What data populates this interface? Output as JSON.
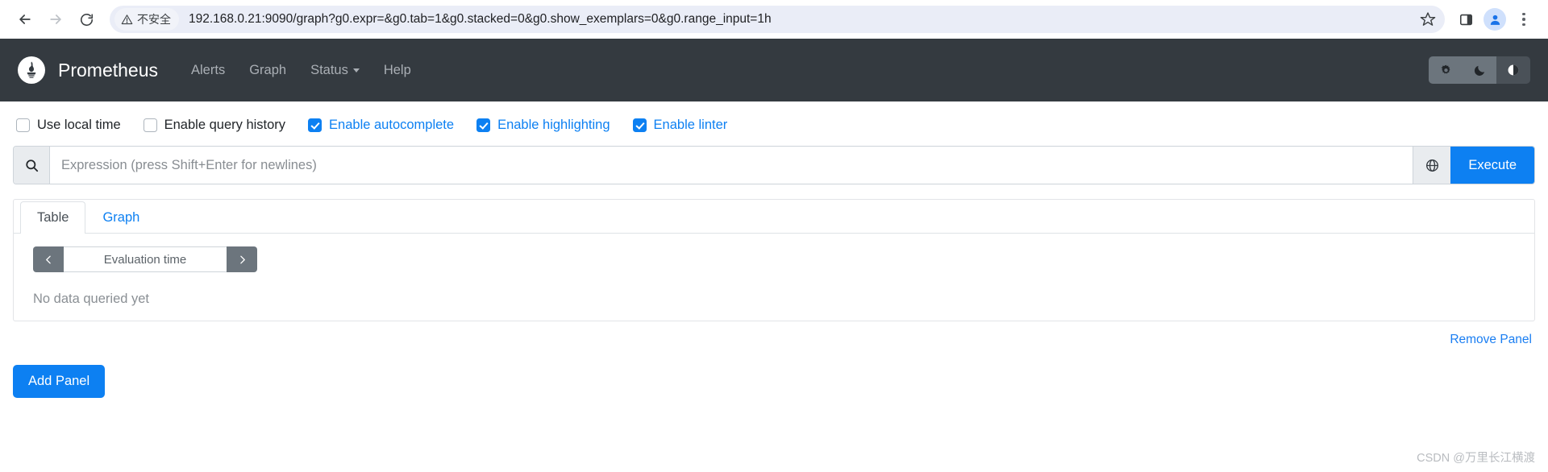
{
  "browser": {
    "back_icon": "back-arrow-icon",
    "forward_icon": "forward-arrow-icon",
    "reload_icon": "reload-icon",
    "security_label": "不安全",
    "security_icon": "warning-triangle-icon",
    "url": "192.168.0.21:9090/graph?g0.expr=&g0.tab=1&g0.stacked=0&g0.show_exemplars=0&g0.range_input=1h",
    "star_icon": "bookmark-star-icon",
    "side_panel_icon": "side-panel-icon",
    "profile_icon": "profile-avatar-icon",
    "menu_icon": "three-dot-menu-icon"
  },
  "navbar": {
    "brand": "Prometheus",
    "logo_icon": "prometheus-torch-icon",
    "links": [
      {
        "label": "Alerts",
        "has_caret": false
      },
      {
        "label": "Graph",
        "has_caret": false
      },
      {
        "label": "Status",
        "has_caret": true
      },
      {
        "label": "Help",
        "has_caret": false
      }
    ],
    "theme_buttons": [
      {
        "name": "theme-light-button",
        "icon": "sun-gear-icon",
        "active": false
      },
      {
        "name": "theme-dark-button",
        "icon": "moon-icon",
        "active": false
      },
      {
        "name": "theme-auto-button",
        "icon": "half-circle-icon",
        "active": true
      }
    ],
    "bg_color": "#343a40"
  },
  "options": [
    {
      "label": "Use local time",
      "checked": false
    },
    {
      "label": "Enable query history",
      "checked": false
    },
    {
      "label": "Enable autocomplete",
      "checked": true
    },
    {
      "label": "Enable highlighting",
      "checked": true
    },
    {
      "label": "Enable linter",
      "checked": true
    }
  ],
  "expression": {
    "search_icon": "search-icon",
    "placeholder": "Expression (press Shift+Enter for newlines)",
    "value": "",
    "globe_icon": "globe-icon",
    "execute_label": "Execute",
    "accent_color": "#0d80f2"
  },
  "panel": {
    "tabs": [
      {
        "label": "Table",
        "active": true
      },
      {
        "label": "Graph",
        "active": false
      }
    ],
    "eval_time": {
      "prev_icon": "chevron-left-icon",
      "next_icon": "chevron-right-icon",
      "placeholder": "Evaluation time",
      "value": ""
    },
    "empty_message": "No data queried yet",
    "remove_label": "Remove Panel"
  },
  "footer": {
    "add_panel_label": "Add Panel"
  },
  "watermark": "CSDN @万里长江横渡"
}
